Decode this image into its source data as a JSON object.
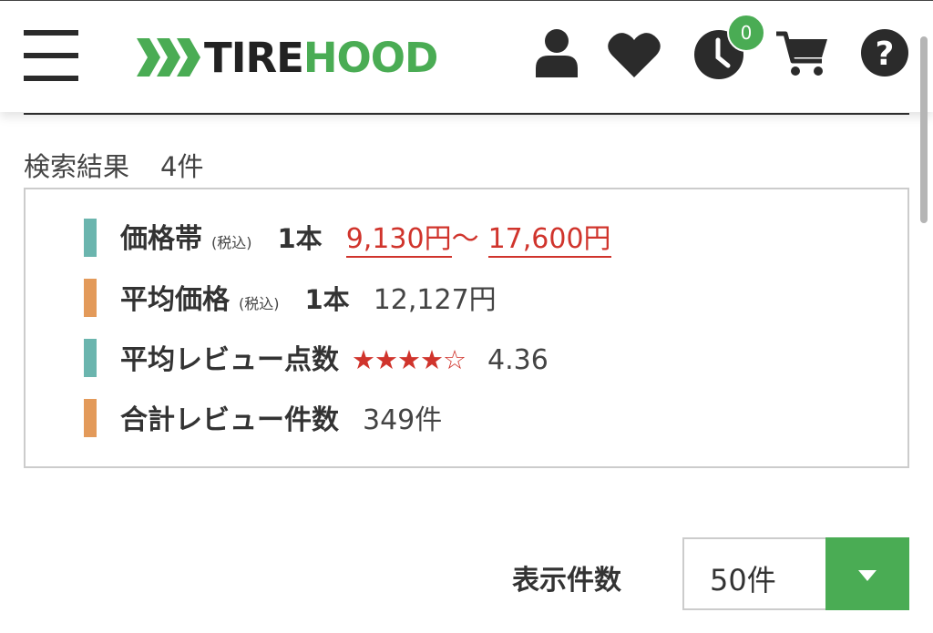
{
  "header": {
    "logo": {
      "part1": "TIRE",
      "part2": "HOOD"
    },
    "history_badge": "0",
    "icons": [
      "menu-icon",
      "user-icon",
      "heart-icon",
      "history-clock-icon",
      "cart-icon",
      "help-icon"
    ]
  },
  "search": {
    "label": "検索結果",
    "count": "4件"
  },
  "summary": {
    "price_range": {
      "label": "価格帯",
      "tax": "(税込)",
      "qty": "1本",
      "min": "9,130円",
      "sep": "〜",
      "max": "17,600円"
    },
    "avg_price": {
      "label": "平均価格",
      "tax": "(税込)",
      "qty": "1本",
      "value": "12,127円"
    },
    "avg_review": {
      "label": "平均レビュー点数",
      "stars": "★★★★☆",
      "value": "4.36",
      "rating_fraction": 0.872
    },
    "total_reviews": {
      "label": "合計レビュー件数",
      "value": "349件"
    }
  },
  "per_page": {
    "label": "表示件数",
    "selected": "50件"
  },
  "colors": {
    "brand_green": "#4aac54",
    "accent_red": "#d0342c",
    "bar_teal": "#6bb5ae",
    "bar_orange": "#e39a5a"
  }
}
